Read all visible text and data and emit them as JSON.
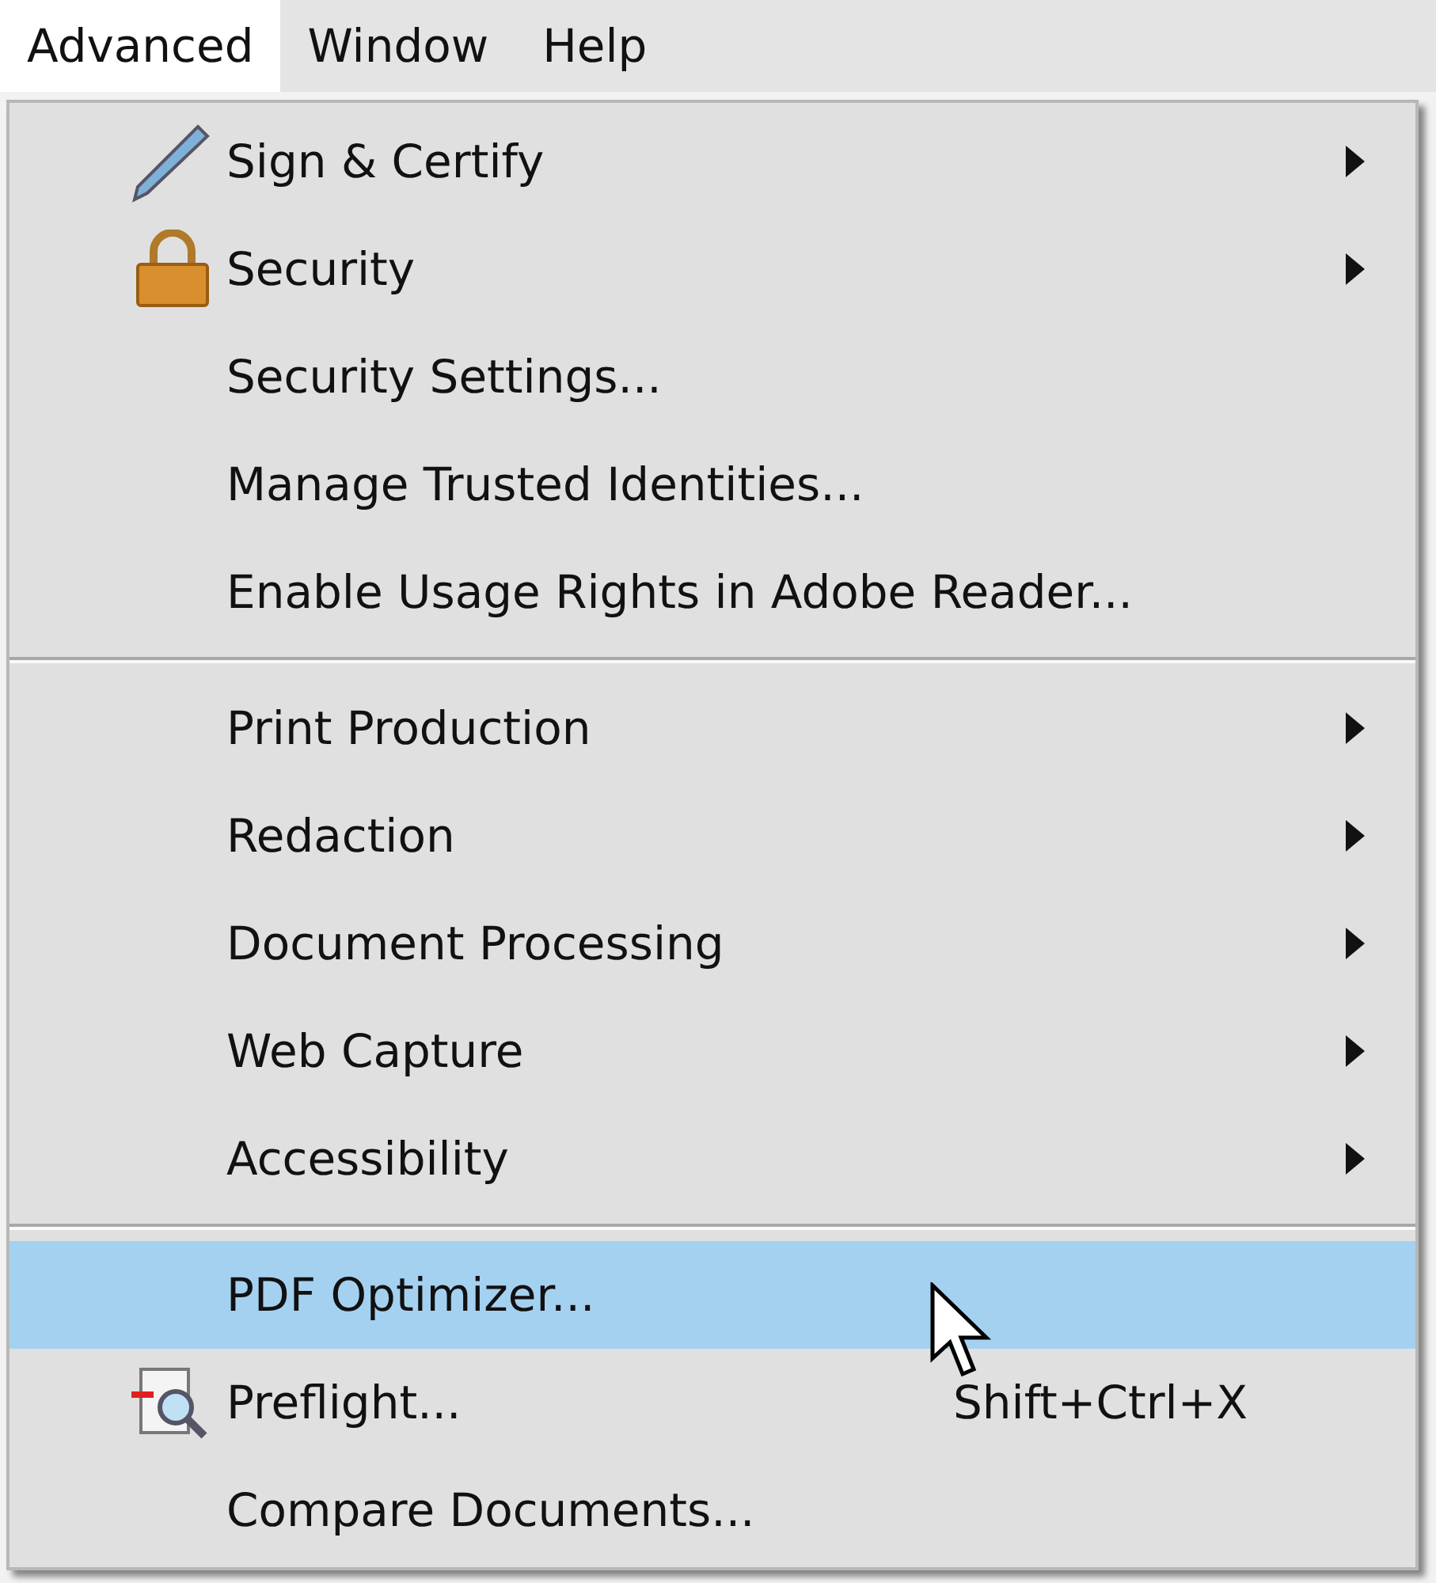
{
  "menubar": [
    {
      "label": "Advanced",
      "selected": true
    },
    {
      "label": "Window",
      "selected": false
    },
    {
      "label": "Help",
      "selected": false
    }
  ],
  "menu": [
    {
      "kind": "pen",
      "label": "Sign & Certify",
      "submenu": true,
      "selected": false
    },
    {
      "kind": "lock",
      "label": "Security",
      "submenu": true,
      "selected": false
    },
    {
      "kind": "item",
      "label": "Security Settings...",
      "submenu": false,
      "selected": false
    },
    {
      "kind": "item",
      "label": "Manage Trusted Identities...",
      "submenu": false,
      "selected": false
    },
    {
      "kind": "item",
      "label": "Enable Usage Rights in Adobe Reader...",
      "submenu": false,
      "selected": false
    },
    {
      "kind": "separator"
    },
    {
      "kind": "item",
      "label": "Print Production",
      "submenu": true,
      "selected": false
    },
    {
      "kind": "item",
      "label": "Redaction",
      "submenu": true,
      "selected": false
    },
    {
      "kind": "item",
      "label": "Document Processing",
      "submenu": true,
      "selected": false
    },
    {
      "kind": "item",
      "label": "Web Capture",
      "submenu": true,
      "selected": false
    },
    {
      "kind": "item",
      "label": "Accessibility",
      "submenu": true,
      "selected": false
    },
    {
      "kind": "separator"
    },
    {
      "kind": "item",
      "label": "PDF Optimizer...",
      "submenu": false,
      "selected": true
    },
    {
      "kind": "preflight",
      "label": "Preflight...",
      "shortcut": "Shift+Ctrl+X",
      "submenu": false,
      "selected": false
    },
    {
      "kind": "item",
      "label": "Compare Documents...",
      "submenu": false,
      "selected": false
    }
  ]
}
